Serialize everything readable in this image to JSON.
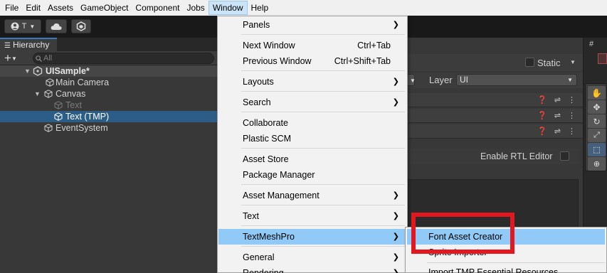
{
  "menubar": {
    "items": [
      "File",
      "Edit",
      "Assets",
      "GameObject",
      "Component",
      "Jobs",
      "Window",
      "Help"
    ],
    "active": "Window"
  },
  "toolbar": {
    "account_label": "T",
    "cloud_icon": "cloud-icon",
    "collab_icon": "collab-icon"
  },
  "hierarchy": {
    "tab_label": "Hierarchy",
    "add_label": "+",
    "search_placeholder": "All",
    "scene_name": "UISample*",
    "items": [
      {
        "label": "Main Camera",
        "depth": 1,
        "expanded": false,
        "state": "normal"
      },
      {
        "label": "Canvas",
        "depth": 1,
        "expanded": true,
        "state": "normal"
      },
      {
        "label": "Text",
        "depth": 2,
        "expanded": false,
        "state": "disabled"
      },
      {
        "label": "Text (TMP)",
        "depth": 2,
        "expanded": false,
        "state": "selected"
      },
      {
        "label": "EventSystem",
        "depth": 1,
        "expanded": false,
        "state": "normal"
      }
    ]
  },
  "inspector": {
    "static_label": "Static",
    "layer_label": "Layer",
    "layer_value": "UI",
    "rtl_label": "Enable RTL Editor"
  },
  "window_menu": {
    "items": [
      {
        "label": "Panels",
        "shortcut": "",
        "submenu": true
      },
      {
        "label": "Next Window",
        "shortcut": "Ctrl+Tab",
        "submenu": false
      },
      {
        "label": "Previous Window",
        "shortcut": "Ctrl+Shift+Tab",
        "submenu": false
      },
      {
        "label": "Layouts",
        "shortcut": "",
        "submenu": true
      },
      {
        "label": "Search",
        "shortcut": "",
        "submenu": true
      },
      {
        "label": "Collaborate",
        "shortcut": "",
        "submenu": false
      },
      {
        "label": "Plastic SCM",
        "shortcut": "",
        "submenu": false
      },
      {
        "label": "Asset Store",
        "shortcut": "",
        "submenu": false
      },
      {
        "label": "Package Manager",
        "shortcut": "",
        "submenu": false
      },
      {
        "label": "Asset Management",
        "shortcut": "",
        "submenu": true
      },
      {
        "label": "Text",
        "shortcut": "",
        "submenu": true
      },
      {
        "label": "TextMeshPro",
        "shortcut": "",
        "submenu": true
      },
      {
        "label": "General",
        "shortcut": "",
        "submenu": true
      },
      {
        "label": "Rendering",
        "shortcut": "",
        "submenu": true
      }
    ],
    "highlighted": "TextMeshPro"
  },
  "tmp_submenu": {
    "items": [
      {
        "label": "Font Asset Creator"
      },
      {
        "label": "Sprite Importer"
      },
      {
        "label": "Import TMP Essential Resources"
      }
    ],
    "highlighted": "Font Asset Creator"
  },
  "colors": {
    "menu_highlight": "#91c9f7",
    "selection_blue": "#2c5d87",
    "annotation_red": "#e3171f"
  }
}
